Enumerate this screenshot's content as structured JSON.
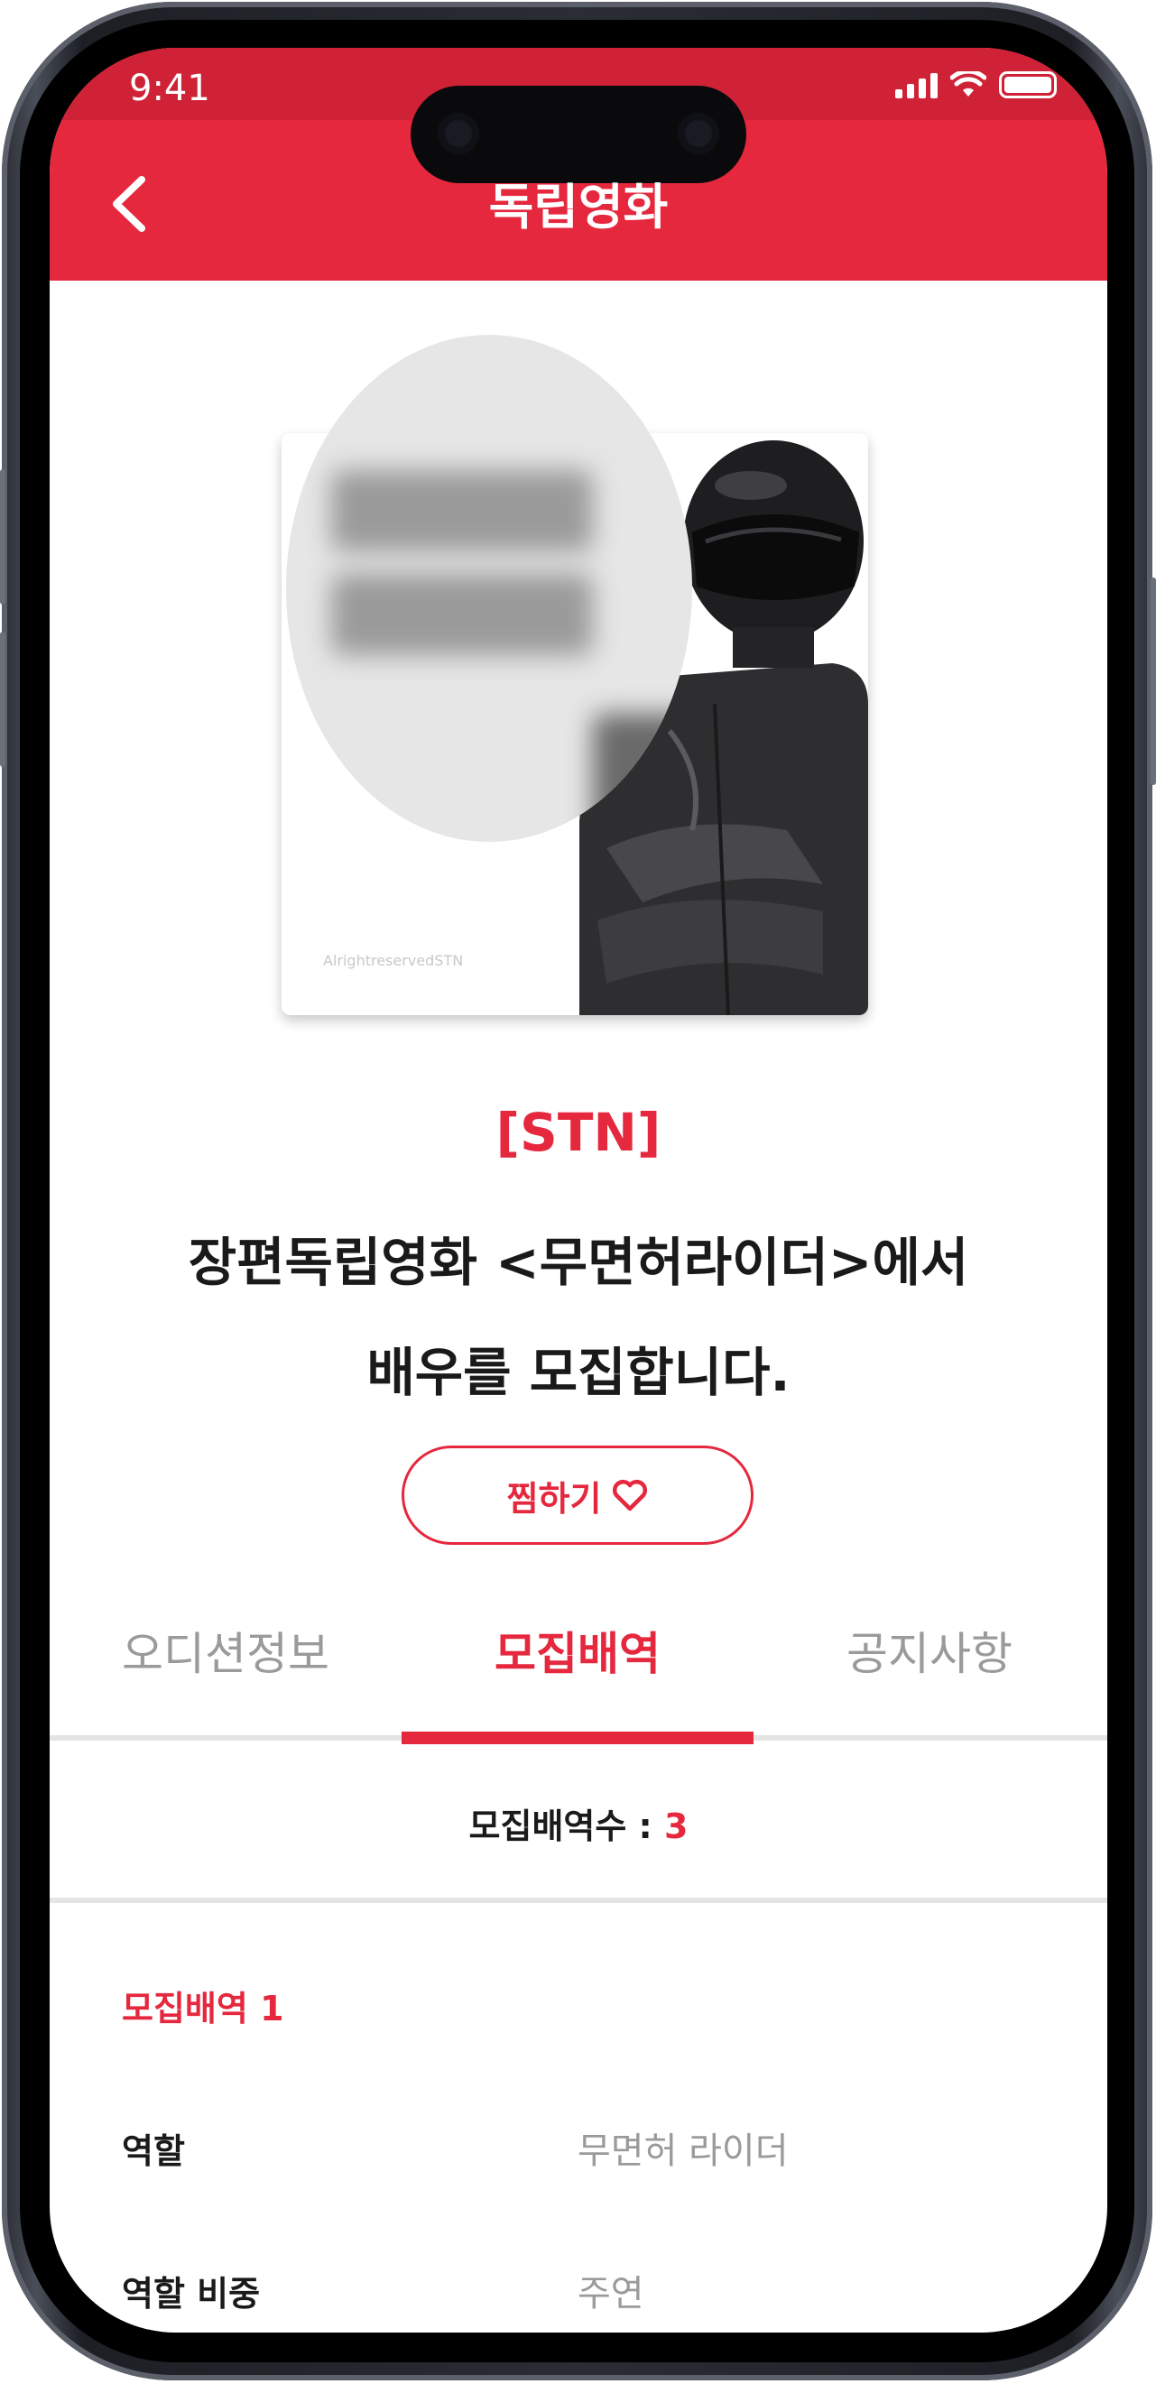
{
  "status_bar": {
    "time": "9:41"
  },
  "header": {
    "title": "독립영화"
  },
  "poster": {
    "caption": "AlrightreservedSTN"
  },
  "production": {
    "company": "[STN]",
    "headline_line1": "장편독립영화 <무면허라이더>에서",
    "headline_line2": "배우를 모집합니다."
  },
  "like_button": {
    "label": "찜하기",
    "icon": "heart-outline-icon"
  },
  "tabs": [
    {
      "label": "오디션정보",
      "active": false
    },
    {
      "label": "모집배역",
      "active": true
    },
    {
      "label": "공지사항",
      "active": false
    }
  ],
  "recruit": {
    "count_label": "모집배역수 : ",
    "count_value": "3"
  },
  "role_section": {
    "title": "모집배역 1",
    "rows": [
      {
        "label": "역할",
        "value": "무면허 라이더"
      },
      {
        "label": "역할 비중",
        "value": "주연"
      }
    ]
  },
  "colors": {
    "accent": "#e5283e",
    "status_bar": "#cf2236",
    "muted_text": "#9a9a9a"
  }
}
